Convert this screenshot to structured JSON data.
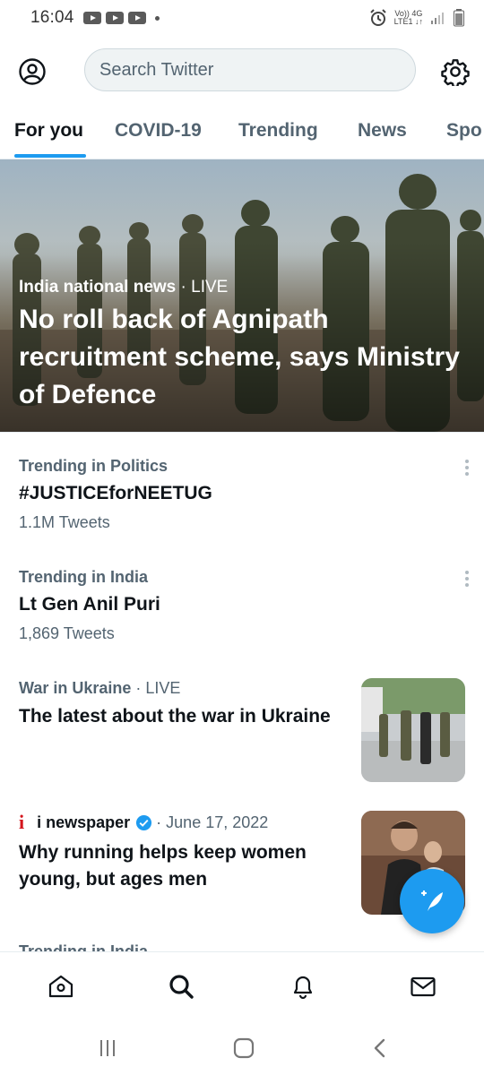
{
  "status_bar": {
    "time": "16:04",
    "network_line1": "Vo)) 4G",
    "network_line2": "LTE1 ↓↑",
    "icons": [
      "youtube-icon",
      "youtube-icon",
      "youtube-icon",
      "alarm-icon",
      "signal-icon",
      "battery-icon"
    ]
  },
  "header": {
    "search_placeholder": "Search Twitter",
    "left_icon": "profile-icon",
    "right_icon": "gear-icon"
  },
  "tabs": [
    {
      "label": "For you",
      "active": true
    },
    {
      "label": "COVID-19",
      "active": false
    },
    {
      "label": "Trending",
      "active": false
    },
    {
      "label": "News",
      "active": false
    },
    {
      "label": "Spo",
      "active": false
    }
  ],
  "hero": {
    "category": "India national news",
    "separator": " · ",
    "live": "LIVE",
    "title": "No roll back of Agnipath recruitment scheme, says Ministry of Defence"
  },
  "trends": [
    {
      "context": "Trending in Politics",
      "name": "#JUSTICEforNEETUG",
      "count": "1.1M Tweets"
    },
    {
      "context": "Trending in India",
      "name": "Lt Gen Anil Puri",
      "count": "1,869 Tweets"
    }
  ],
  "stories": [
    {
      "context": "War in Ukraine",
      "separator": " · ",
      "live": "LIVE",
      "title": "The latest about the war in Ukraine"
    },
    {
      "source": "i newspaper",
      "logo": "i",
      "date": "· June 17, 2022",
      "title": "Why running helps keep women young, but ages men"
    }
  ],
  "partial_item": {
    "context": "Trending in India"
  },
  "bottom_nav": [
    "home-icon",
    "search-icon",
    "bell-icon",
    "mail-icon"
  ],
  "colors": {
    "accent": "#1d9bf0",
    "text": "#0f1419",
    "secondary": "#536471",
    "logo_red": "#d4161d"
  }
}
